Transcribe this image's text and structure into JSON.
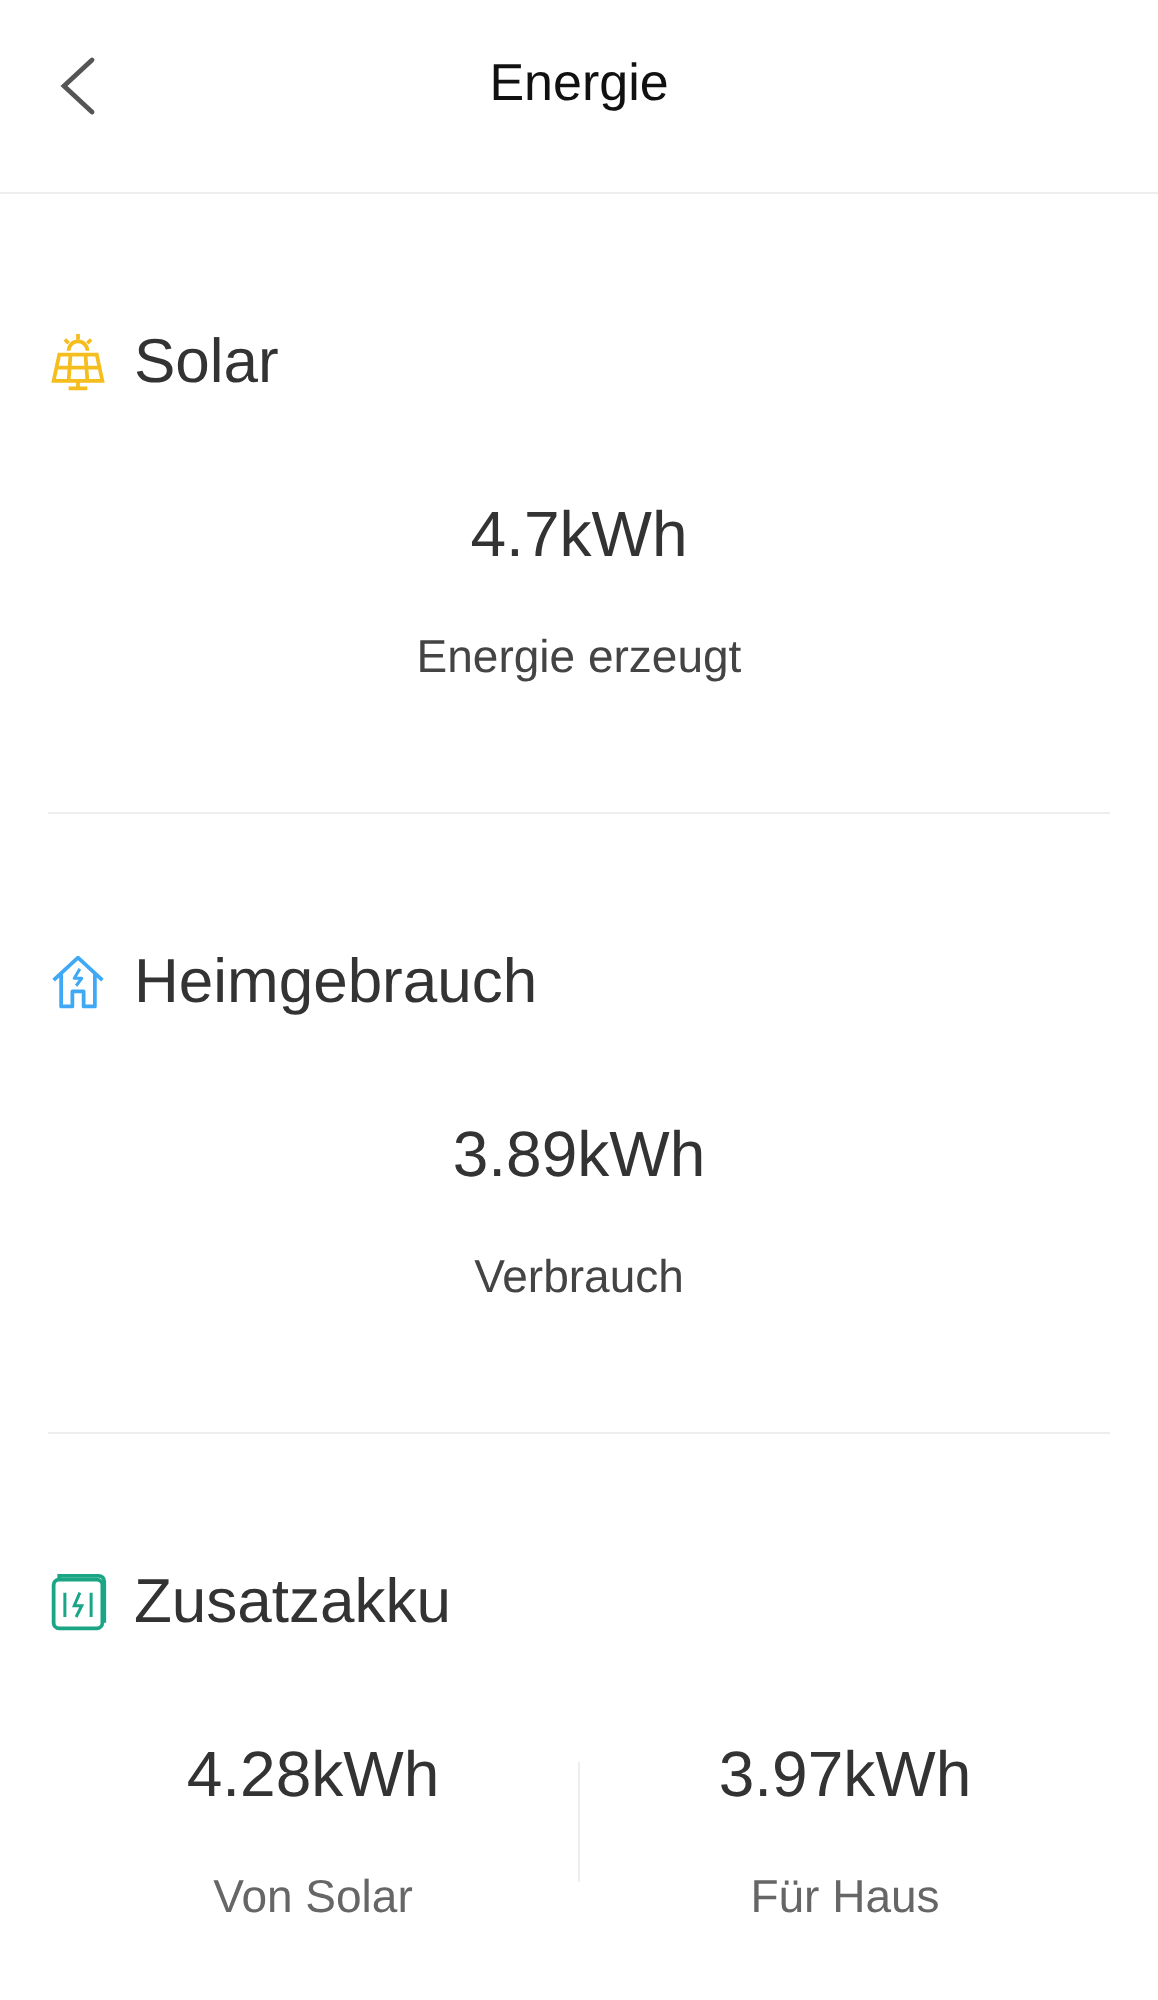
{
  "header": {
    "title": "Energie"
  },
  "sections": [
    {
      "kind": "solar",
      "title": "Solar",
      "stats": [
        {
          "value": "4.7kWh",
          "label": "Energie erzeugt"
        }
      ]
    },
    {
      "kind": "home",
      "title": "Heimgebrauch",
      "stats": [
        {
          "value": "3.89kWh",
          "label": "Verbrauch"
        }
      ]
    },
    {
      "kind": "battery",
      "title": "Zusatzakku",
      "stats": [
        {
          "value": "4.28kWh",
          "label": "Von Solar"
        },
        {
          "value": "3.97kWh",
          "label": "Für Haus"
        }
      ]
    }
  ]
}
